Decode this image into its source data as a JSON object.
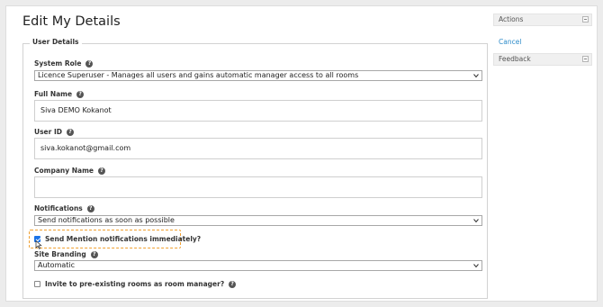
{
  "page": {
    "title": "Edit My Details"
  },
  "user_details": {
    "legend": "User Details",
    "system_role": {
      "label": "System Role",
      "value": "Licence Superuser - Manages all users and gains automatic manager access to all rooms"
    },
    "full_name": {
      "label": "Full Name",
      "value": "Siva DEMO Kokanot"
    },
    "user_id": {
      "label": "User ID",
      "value": "siva.kokanot@gmail.com"
    },
    "company_name": {
      "label": "Company Name",
      "value": ""
    },
    "notifications": {
      "label": "Notifications",
      "value": "Send notifications as soon as possible"
    },
    "send_mention": {
      "label": "Send Mention notifications immediately?",
      "checked": true
    },
    "site_branding": {
      "label": "Site Branding",
      "value": "Automatic"
    },
    "invite": {
      "label": "Invite to pre-existing rooms as room manager?",
      "checked": false
    }
  },
  "sidebar": {
    "actions": {
      "title": "Actions",
      "links": [
        "Cancel"
      ]
    },
    "feedback": {
      "title": "Feedback"
    }
  },
  "colors": {
    "link": "#2c8bc9",
    "highlight": "#f0a030",
    "checkbox": "#1a73e8"
  }
}
